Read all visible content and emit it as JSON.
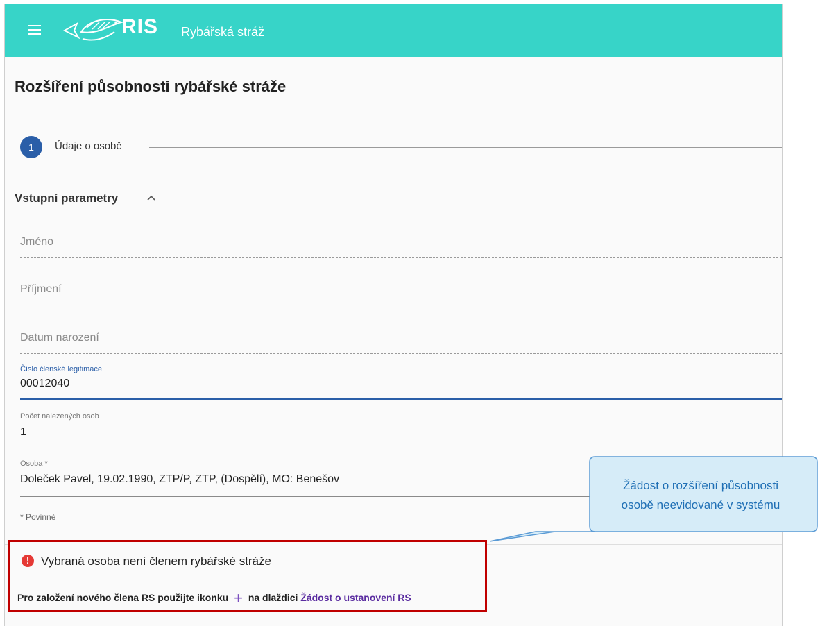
{
  "header": {
    "logo_text": "RIS",
    "app_title": "Rybářská stráž",
    "colors": {
      "bar": "#37d4c8",
      "text": "#ffffff"
    }
  },
  "page": {
    "title": "Rozšíření působnosti rybářské stráže"
  },
  "stepper": {
    "number": "1",
    "label": "Údaje o osobě"
  },
  "section": {
    "title": "Vstupní parametry",
    "icon": "chevron-up-icon"
  },
  "form": {
    "first_name": {
      "placeholder": "Jméno"
    },
    "last_name": {
      "placeholder": "Příjmení"
    },
    "birth_date": {
      "placeholder": "Datum narození"
    },
    "member_id": {
      "label": "Číslo členské legitimace",
      "value": "00012040"
    },
    "found_count": {
      "label": "Počet nalezených osob",
      "value": "1"
    },
    "person": {
      "label": "Osoba *",
      "value": "Doleček Pavel, 19.02.1990, ZTP/P, ZTP, (Dospělí), MO: Benešov"
    },
    "required_note": "* Povinné"
  },
  "alert": {
    "icon": "error-icon",
    "title": "Vybraná osoba není členem rybářské stráže",
    "text_before": "Pro založení nového člena RS použijte ikonku",
    "plus_glyph": "+",
    "text_middle": "na dlaždici",
    "link": "Žádost o ustanovení RS",
    "border_color": "#c00000"
  },
  "callout": {
    "line1": "Žádost o rozšíření působnosti",
    "line2": "osobě neevidované v systému"
  }
}
